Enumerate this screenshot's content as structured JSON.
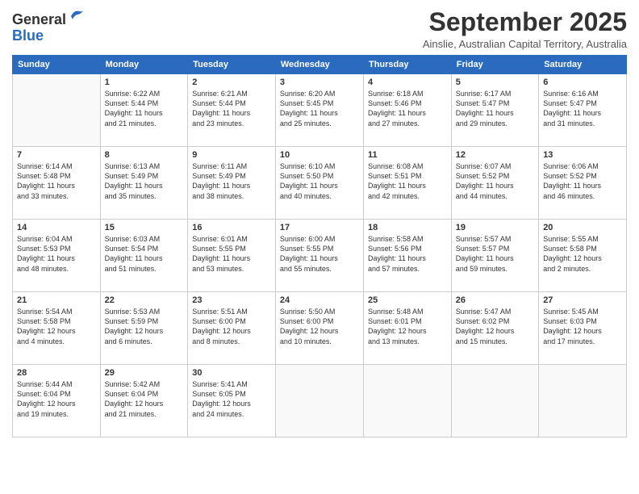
{
  "header": {
    "logo_line1": "General",
    "logo_line2": "Blue",
    "month": "September 2025",
    "location": "Ainslie, Australian Capital Territory, Australia"
  },
  "days_of_week": [
    "Sunday",
    "Monday",
    "Tuesday",
    "Wednesday",
    "Thursday",
    "Friday",
    "Saturday"
  ],
  "weeks": [
    [
      {
        "day": "",
        "info": ""
      },
      {
        "day": "1",
        "info": "Sunrise: 6:22 AM\nSunset: 5:44 PM\nDaylight: 11 hours\nand 21 minutes."
      },
      {
        "day": "2",
        "info": "Sunrise: 6:21 AM\nSunset: 5:44 PM\nDaylight: 11 hours\nand 23 minutes."
      },
      {
        "day": "3",
        "info": "Sunrise: 6:20 AM\nSunset: 5:45 PM\nDaylight: 11 hours\nand 25 minutes."
      },
      {
        "day": "4",
        "info": "Sunrise: 6:18 AM\nSunset: 5:46 PM\nDaylight: 11 hours\nand 27 minutes."
      },
      {
        "day": "5",
        "info": "Sunrise: 6:17 AM\nSunset: 5:47 PM\nDaylight: 11 hours\nand 29 minutes."
      },
      {
        "day": "6",
        "info": "Sunrise: 6:16 AM\nSunset: 5:47 PM\nDaylight: 11 hours\nand 31 minutes."
      }
    ],
    [
      {
        "day": "7",
        "info": "Sunrise: 6:14 AM\nSunset: 5:48 PM\nDaylight: 11 hours\nand 33 minutes."
      },
      {
        "day": "8",
        "info": "Sunrise: 6:13 AM\nSunset: 5:49 PM\nDaylight: 11 hours\nand 35 minutes."
      },
      {
        "day": "9",
        "info": "Sunrise: 6:11 AM\nSunset: 5:49 PM\nDaylight: 11 hours\nand 38 minutes."
      },
      {
        "day": "10",
        "info": "Sunrise: 6:10 AM\nSunset: 5:50 PM\nDaylight: 11 hours\nand 40 minutes."
      },
      {
        "day": "11",
        "info": "Sunrise: 6:08 AM\nSunset: 5:51 PM\nDaylight: 11 hours\nand 42 minutes."
      },
      {
        "day": "12",
        "info": "Sunrise: 6:07 AM\nSunset: 5:52 PM\nDaylight: 11 hours\nand 44 minutes."
      },
      {
        "day": "13",
        "info": "Sunrise: 6:06 AM\nSunset: 5:52 PM\nDaylight: 11 hours\nand 46 minutes."
      }
    ],
    [
      {
        "day": "14",
        "info": "Sunrise: 6:04 AM\nSunset: 5:53 PM\nDaylight: 11 hours\nand 48 minutes."
      },
      {
        "day": "15",
        "info": "Sunrise: 6:03 AM\nSunset: 5:54 PM\nDaylight: 11 hours\nand 51 minutes."
      },
      {
        "day": "16",
        "info": "Sunrise: 6:01 AM\nSunset: 5:55 PM\nDaylight: 11 hours\nand 53 minutes."
      },
      {
        "day": "17",
        "info": "Sunrise: 6:00 AM\nSunset: 5:55 PM\nDaylight: 11 hours\nand 55 minutes."
      },
      {
        "day": "18",
        "info": "Sunrise: 5:58 AM\nSunset: 5:56 PM\nDaylight: 11 hours\nand 57 minutes."
      },
      {
        "day": "19",
        "info": "Sunrise: 5:57 AM\nSunset: 5:57 PM\nDaylight: 11 hours\nand 59 minutes."
      },
      {
        "day": "20",
        "info": "Sunrise: 5:55 AM\nSunset: 5:58 PM\nDaylight: 12 hours\nand 2 minutes."
      }
    ],
    [
      {
        "day": "21",
        "info": "Sunrise: 5:54 AM\nSunset: 5:58 PM\nDaylight: 12 hours\nand 4 minutes."
      },
      {
        "day": "22",
        "info": "Sunrise: 5:53 AM\nSunset: 5:59 PM\nDaylight: 12 hours\nand 6 minutes."
      },
      {
        "day": "23",
        "info": "Sunrise: 5:51 AM\nSunset: 6:00 PM\nDaylight: 12 hours\nand 8 minutes."
      },
      {
        "day": "24",
        "info": "Sunrise: 5:50 AM\nSunset: 6:00 PM\nDaylight: 12 hours\nand 10 minutes."
      },
      {
        "day": "25",
        "info": "Sunrise: 5:48 AM\nSunset: 6:01 PM\nDaylight: 12 hours\nand 13 minutes."
      },
      {
        "day": "26",
        "info": "Sunrise: 5:47 AM\nSunset: 6:02 PM\nDaylight: 12 hours\nand 15 minutes."
      },
      {
        "day": "27",
        "info": "Sunrise: 5:45 AM\nSunset: 6:03 PM\nDaylight: 12 hours\nand 17 minutes."
      }
    ],
    [
      {
        "day": "28",
        "info": "Sunrise: 5:44 AM\nSunset: 6:04 PM\nDaylight: 12 hours\nand 19 minutes."
      },
      {
        "day": "29",
        "info": "Sunrise: 5:42 AM\nSunset: 6:04 PM\nDaylight: 12 hours\nand 21 minutes."
      },
      {
        "day": "30",
        "info": "Sunrise: 5:41 AM\nSunset: 6:05 PM\nDaylight: 12 hours\nand 24 minutes."
      },
      {
        "day": "",
        "info": ""
      },
      {
        "day": "",
        "info": ""
      },
      {
        "day": "",
        "info": ""
      },
      {
        "day": "",
        "info": ""
      }
    ]
  ]
}
